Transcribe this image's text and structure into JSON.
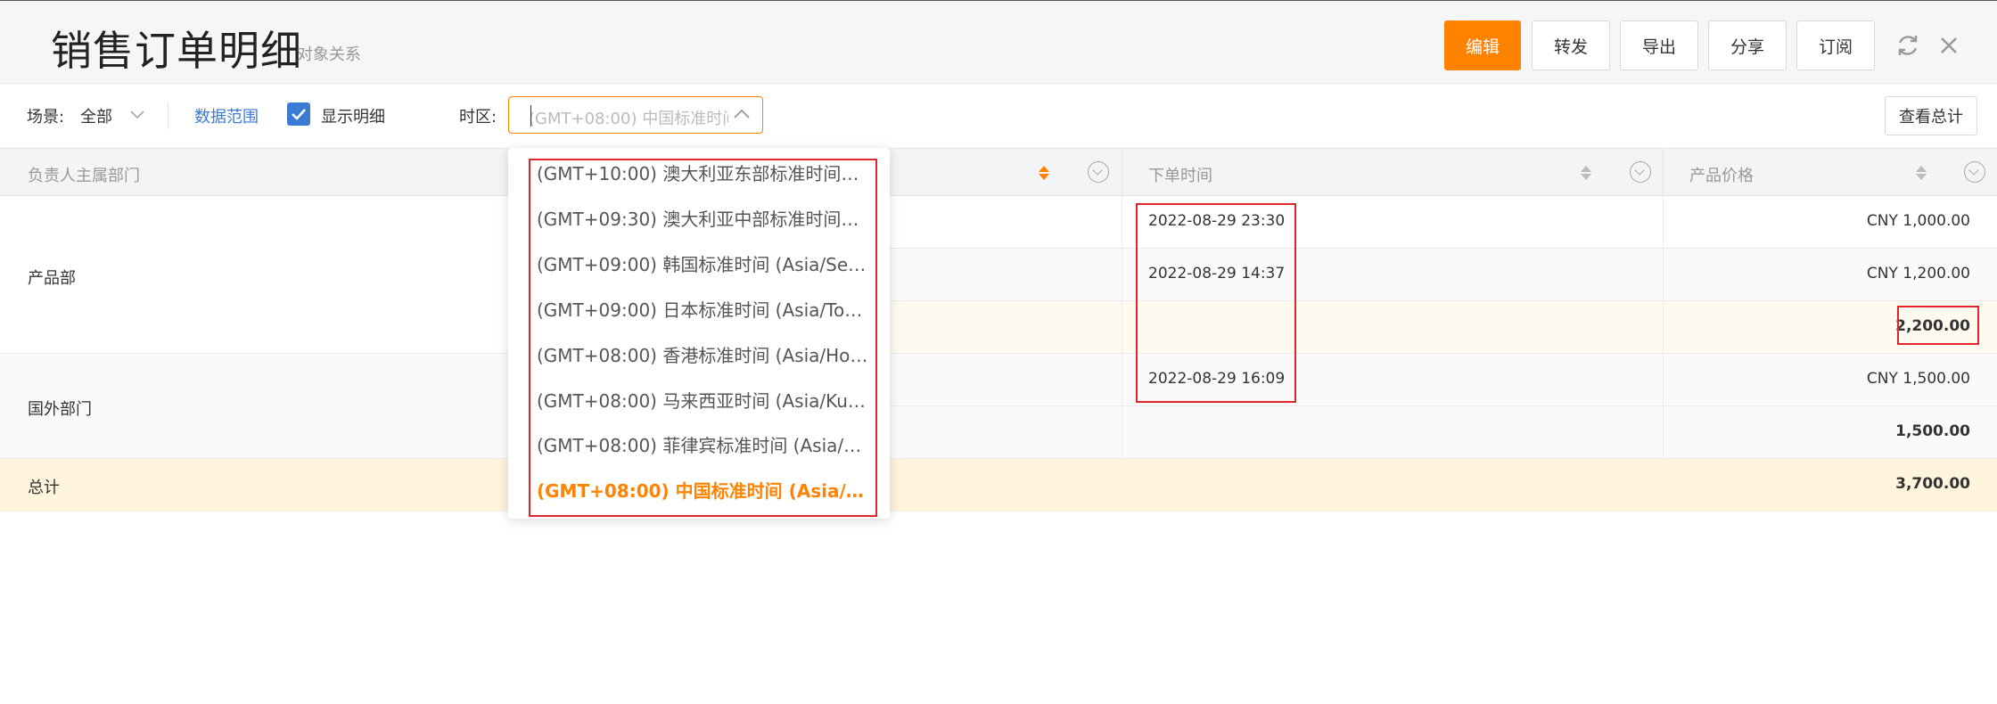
{
  "header": {
    "title": "销售订单明细",
    "subtitle": "对象关系",
    "buttons": {
      "edit": "编辑",
      "forward": "转发",
      "export": "导出",
      "share": "分享",
      "subscribe": "订阅"
    },
    "icons": [
      "refresh-icon",
      "close-icon"
    ]
  },
  "toolbar": {
    "scene_label": "场景:",
    "scene_value": "全部",
    "data_range": "数据范围",
    "show_detail_label": "显示明细",
    "show_detail_checked": true,
    "timezone_label": "时区:",
    "timezone_value": "(GMT+08:00) 中国标准时间",
    "summary_button": "查看总计"
  },
  "timezone_options": [
    "(GMT+10:00) 澳大利亚东部标准时间…",
    "(GMT+09:30) 澳大利亚中部标准时间…",
    "(GMT+09:00) 韩国标准时间 (Asia/Se…",
    "(GMT+09:00) 日本标准时间 (Asia/To…",
    "(GMT+08:00) 香港标准时间 (Asia/Ho…",
    "(GMT+08:00) 马来西亚时间 (Asia/Ku…",
    "(GMT+08:00) 菲律宾标准时间 (Asia/…",
    "(GMT+08:00) 中国标准时间 (Asia/S…"
  ],
  "selected_timezone_index": 7,
  "table": {
    "columns": [
      "负责人主属部门",
      "下单时间",
      "产品价格"
    ],
    "groups": [
      {
        "department": "产品部",
        "rows": [
          {
            "order_time": "2022-08-29 23:30",
            "price": "CNY 1,000.00"
          },
          {
            "order_time": "2022-08-29 14:37",
            "price": "CNY 1,200.00"
          }
        ],
        "subtotal": "2,200.00"
      },
      {
        "department": "国外部门",
        "rows": [
          {
            "order_time": "2022-08-29 16:09",
            "price": "CNY 1,500.00"
          }
        ],
        "subtotal": "1,500.00"
      }
    ],
    "total_label": "总计",
    "total_value": "3,700.00"
  },
  "colors": {
    "accent": "#ff8200",
    "link": "#3a7bd5",
    "highlight_border": "#e0262c"
  }
}
